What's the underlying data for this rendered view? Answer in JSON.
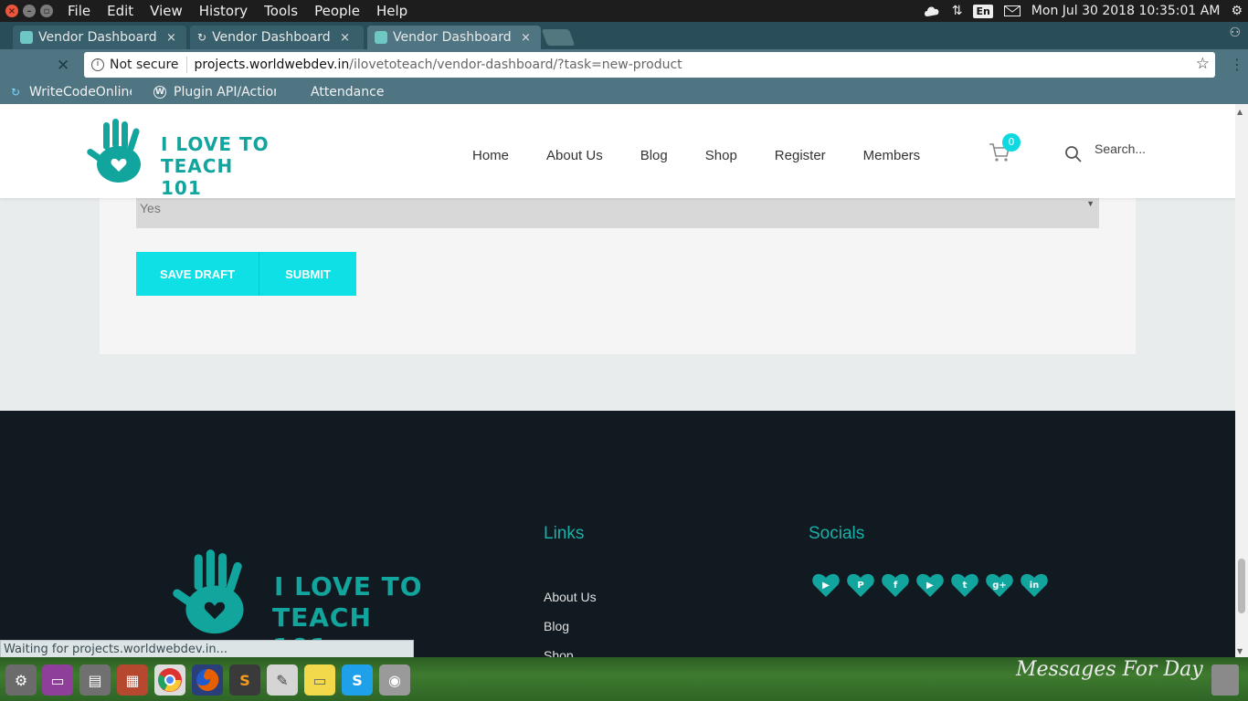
{
  "os": {
    "menu": [
      "File",
      "Edit",
      "View",
      "History",
      "Tools",
      "People",
      "Help"
    ],
    "lang": "En",
    "clock": "Mon Jul 30 2018 10:35:01 AM"
  },
  "tabs": [
    {
      "label": "Vendor Dashboard",
      "close": "×"
    },
    {
      "label": "Vendor Dashboard",
      "close": "×"
    },
    {
      "label": "Vendor Dashboard",
      "close": "×"
    }
  ],
  "omnibox": {
    "security": "Not secure",
    "host": "projects.worldwebdev.in",
    "path": "/ilovetoteach/vendor-dashboard/?task=new-product"
  },
  "bookmarks": [
    "WriteCodeOnline",
    "Plugin API/Action",
    "Attendance"
  ],
  "site": {
    "logo_line1": "I LOVE TO",
    "logo_line2": "TEACH 101",
    "nav": [
      "Home",
      "About Us",
      "Blog",
      "Shop",
      "Register",
      "Members"
    ],
    "cart_count": "0",
    "search_placeholder": "Search..."
  },
  "form": {
    "select_value": "Yes",
    "save_draft": "SAVE DRAFT",
    "submit": "SUBMIT"
  },
  "footer": {
    "links_title": "Links",
    "socials_title": "Socials",
    "links": [
      "About Us",
      "Blog",
      "Shop"
    ],
    "social_icons": [
      "youtube-icon",
      "pinterest-icon",
      "facebook-icon",
      "youtube-icon",
      "twitter-icon",
      "google-plus-icon",
      "linkedin-icon"
    ]
  },
  "status": "Waiting for projects.worldwebdev.in...",
  "wallpaper_text": "Messages For Day",
  "colors": {
    "brand_teal": "#12a59e",
    "cta_cyan": "#0fe0e6",
    "footer_bg": "#101a20",
    "browser_frame": "#4f7583"
  }
}
